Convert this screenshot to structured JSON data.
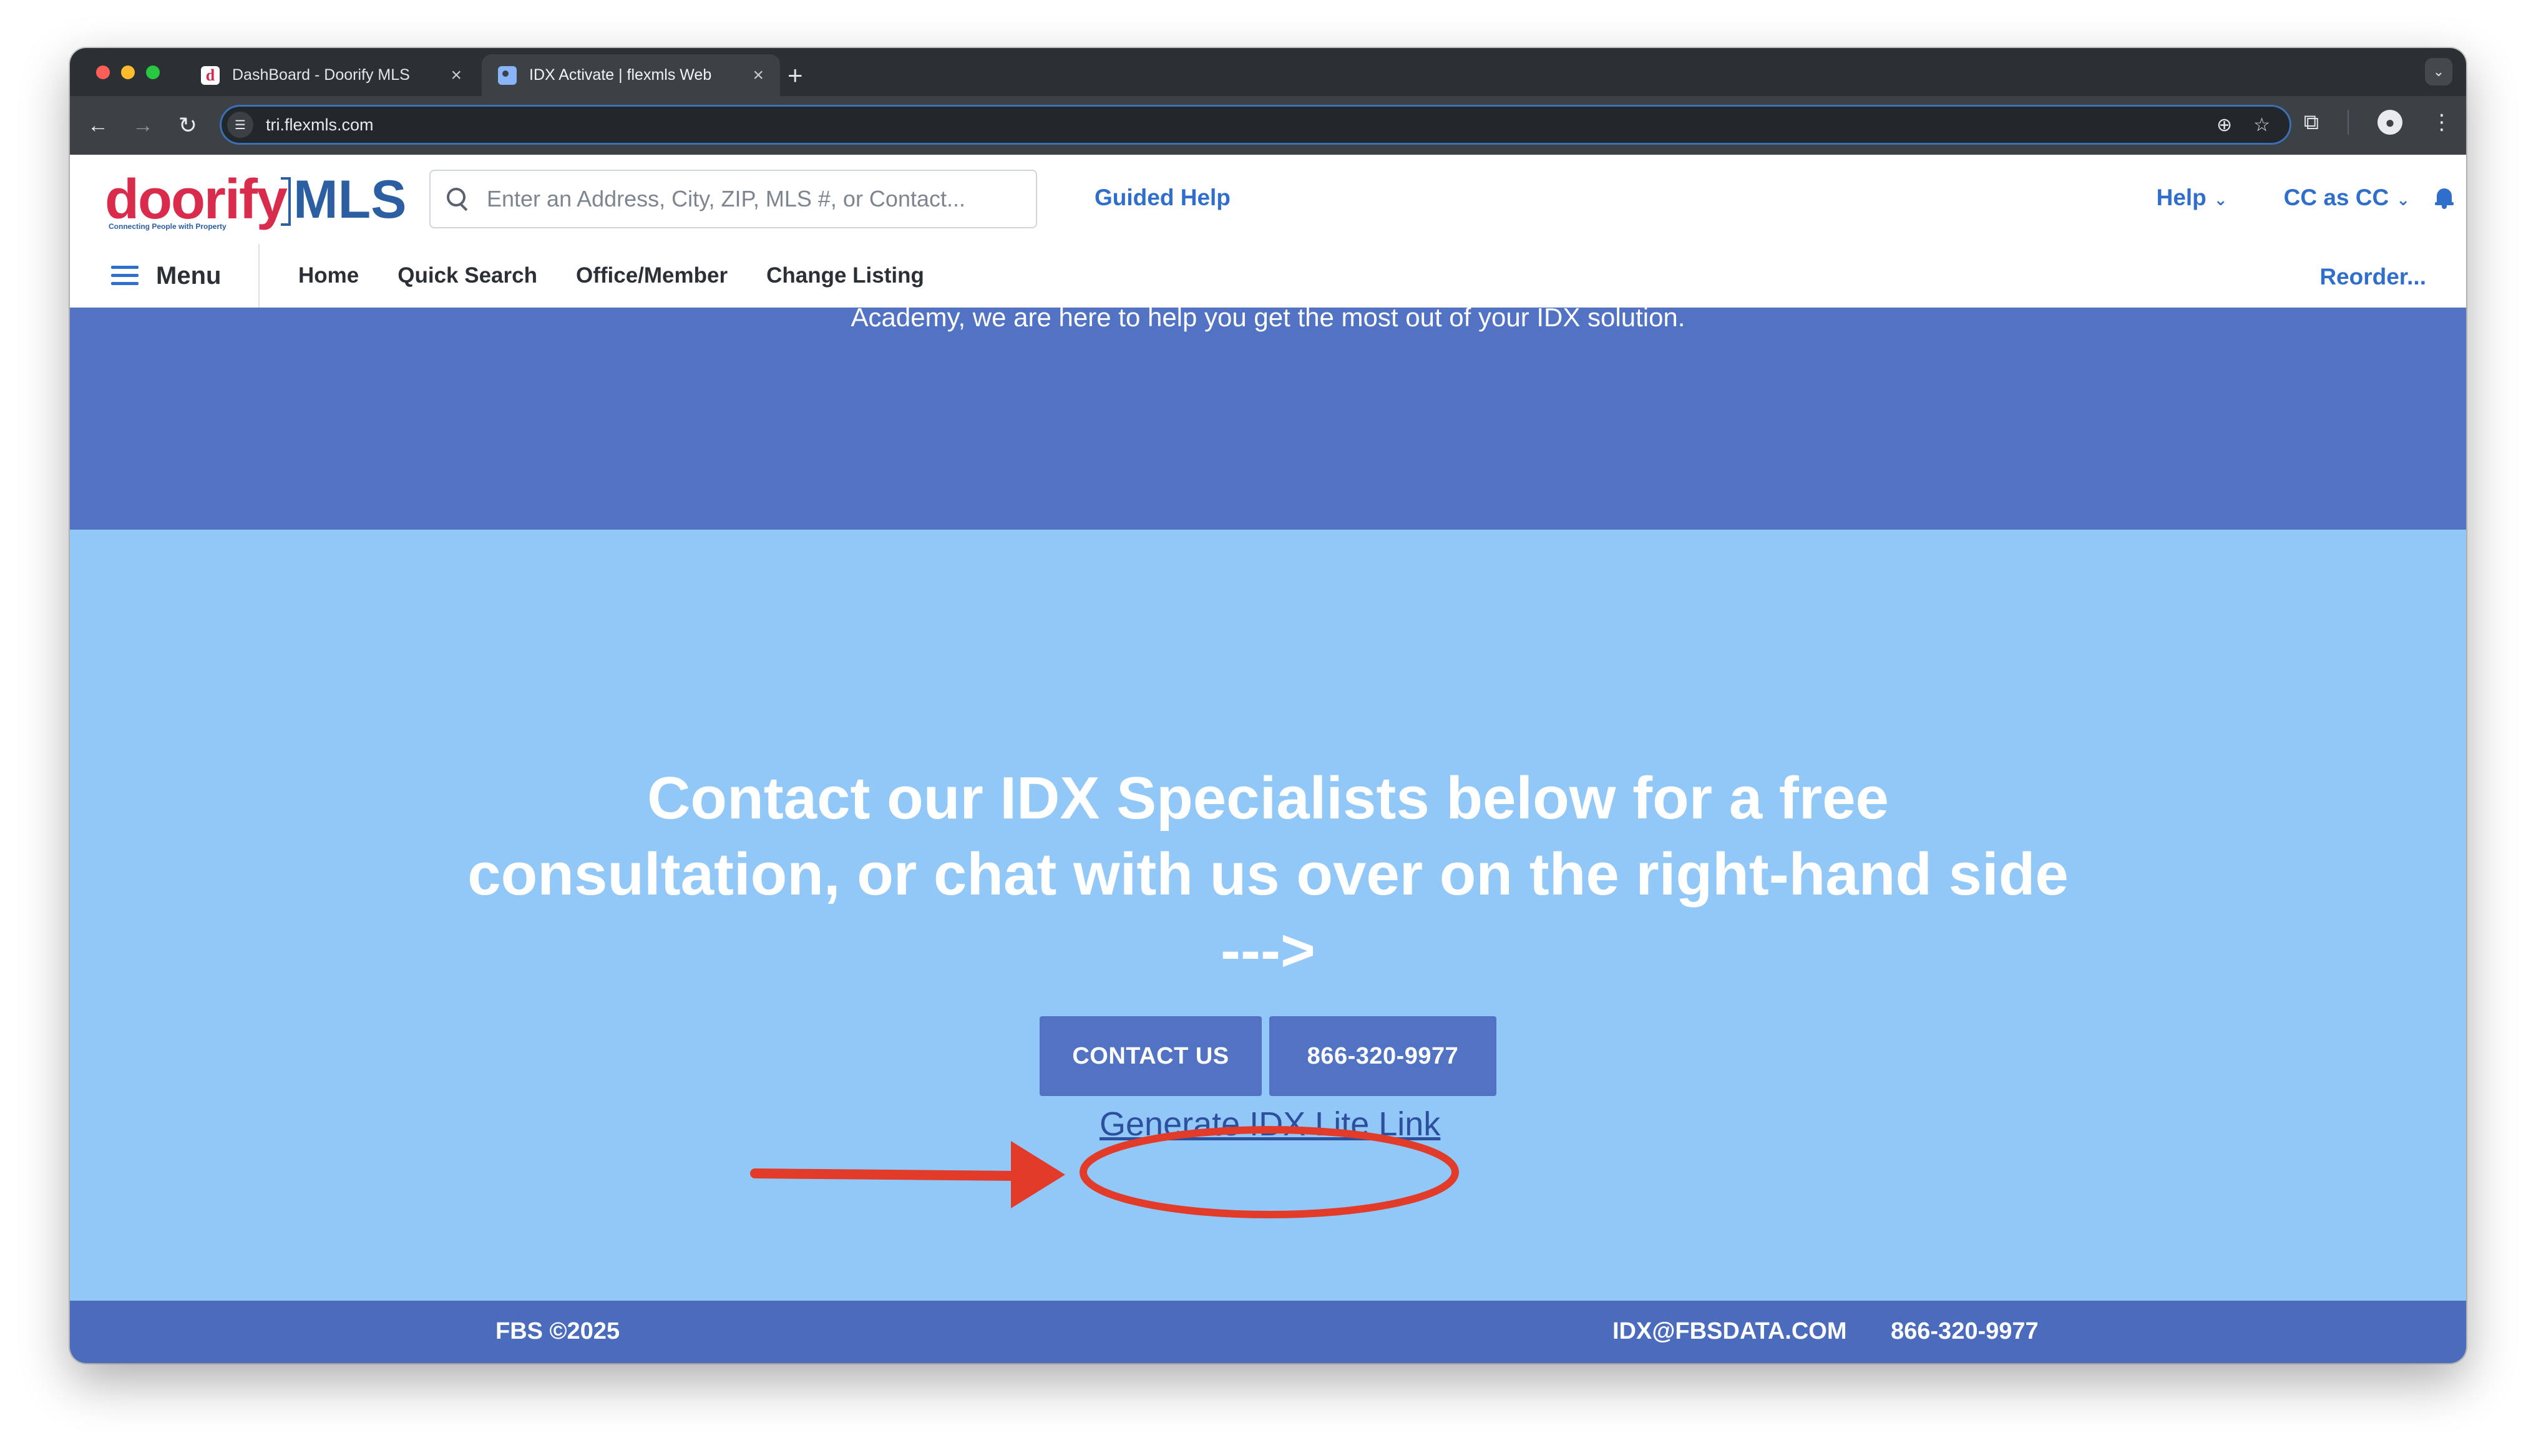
{
  "browser": {
    "tabs": [
      {
        "title": "DashBoard - Doorify MLS",
        "favicon": "doorify-d-icon",
        "active": false
      },
      {
        "title": "IDX Activate | flexmls Web",
        "favicon": "globe-icon",
        "active": true
      }
    ],
    "url": "tri.flexmls.com"
  },
  "header": {
    "logo_brand": "doorify",
    "logo_mls": "MLS",
    "logo_tagline": "Connecting People with Property",
    "search_placeholder": "Enter an Address, City, ZIP, MLS #, or Contact...",
    "guided_help": "Guided Help",
    "help": "Help",
    "user": "CC as CC"
  },
  "nav": {
    "menu": "Menu",
    "links": [
      "Home",
      "Quick Search",
      "Office/Member",
      "Change Listing"
    ],
    "reorder": "Reorder..."
  },
  "content": {
    "academy_text": "Academy, we are here to help you get the most out of your IDX solution.",
    "headline": "Contact our IDX Specialists below for a free consultation, or chat with us over on the right-hand side --->",
    "contact_button": "CONTACT US",
    "phone_button": "866-320-9977",
    "idx_lite_link": "Generate IDX Lite Link"
  },
  "footer": {
    "copyright": "FBS ©2025",
    "email": "IDX@FBSDATA.COM",
    "phone": "866-320-9977"
  },
  "colors": {
    "brand_red": "#d92b4c",
    "brand_blue": "#2c5ea2",
    "link_blue": "#2f6fcb",
    "band_dark": "#5272c3",
    "band_light": "#91c8f8",
    "annotation_red": "#e23b2a"
  }
}
